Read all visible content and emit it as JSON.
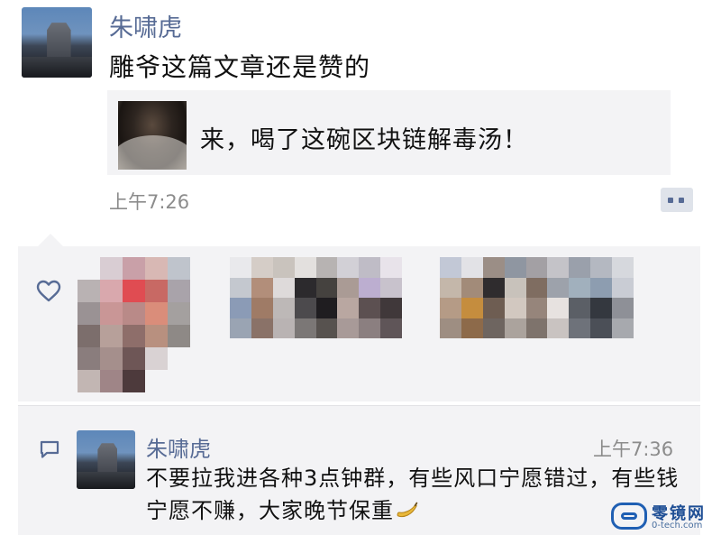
{
  "post": {
    "author": "朱啸虎",
    "text": "雕爷这篇文章还是赞的",
    "share": {
      "title": "来，喝了这碗区块链解毒汤！"
    },
    "time": "上午7:26"
  },
  "comment": {
    "author": "朱啸虎",
    "time": "上午7:36",
    "text": "不要拉我进各种3点钟群，有些风口宁愿错过，有些钱宁愿不赚，大家晚节保重"
  },
  "watermark": {
    "name": "零镜网",
    "url": "0-tech.com"
  },
  "colors": {
    "link_blue": "#576b95",
    "panel_bg": "#f3f3f5",
    "timestamp_gray": "#8c8c8c",
    "watermark_blue": "#1f5fb3"
  },
  "icons": {
    "like": "heart-icon",
    "comment": "comment-bubble-icon",
    "more": "comment-action-icon"
  }
}
